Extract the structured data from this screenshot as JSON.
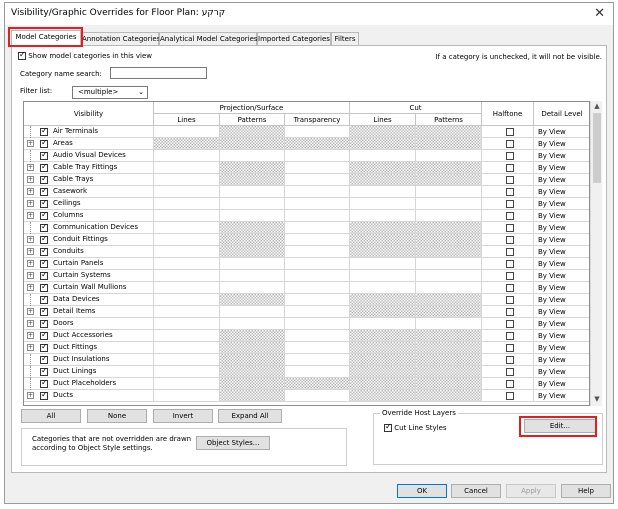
{
  "dialog": {
    "title": "Visibility/Graphic Overrides for Floor Plan: קרקע",
    "close_glyph": "✕"
  },
  "tabs": [
    {
      "label": "Model Categories",
      "active": true
    },
    {
      "label": "Annotation Categories",
      "active": false
    },
    {
      "label": "Analytical Model Categories",
      "active": false
    },
    {
      "label": "Imported Categories",
      "active": false
    },
    {
      "label": "Filters",
      "active": false
    }
  ],
  "model": {
    "show_categories_label": "Show model categories in this view",
    "show_categories_checked": true,
    "unchecked_note": "If a category is unchecked, it will not be visible.",
    "search_label": "Category name search:",
    "search_value": "",
    "filter_label": "Filter list:",
    "filter_value": "<multiple>"
  },
  "table": {
    "headers": {
      "visibility": "Visibility",
      "projection_group": "Projection/Surface",
      "lines": "Lines",
      "patterns": "Patterns",
      "transparency": "Transparency",
      "cut_group": "Cut",
      "cut_lines": "Lines",
      "cut_patterns": "Patterns",
      "halftone": "Halftone",
      "detail_level": "Detail Level"
    },
    "rows": [
      {
        "name": "Air Terminals",
        "expandable": false,
        "checked": true,
        "hatch": [
          false,
          true,
          false,
          true,
          true
        ],
        "detail": "By View"
      },
      {
        "name": "Areas",
        "expandable": true,
        "checked": true,
        "hatch": [
          true,
          true,
          true,
          true,
          true
        ],
        "detail": "By View"
      },
      {
        "name": "Audio Visual Devices",
        "expandable": false,
        "checked": true,
        "hatch": [
          false,
          false,
          false,
          false,
          false
        ],
        "detail": "By View"
      },
      {
        "name": "Cable Tray Fittings",
        "expandable": true,
        "checked": true,
        "hatch": [
          false,
          true,
          false,
          true,
          true
        ],
        "detail": "By View"
      },
      {
        "name": "Cable Trays",
        "expandable": true,
        "checked": true,
        "hatch": [
          false,
          true,
          false,
          true,
          true
        ],
        "detail": "By View"
      },
      {
        "name": "Casework",
        "expandable": true,
        "checked": true,
        "hatch": [
          false,
          false,
          false,
          false,
          false
        ],
        "detail": "By View"
      },
      {
        "name": "Ceilings",
        "expandable": true,
        "checked": true,
        "hatch": [
          false,
          false,
          false,
          false,
          false
        ],
        "detail": "By View"
      },
      {
        "name": "Columns",
        "expandable": true,
        "checked": true,
        "hatch": [
          false,
          false,
          false,
          false,
          false
        ],
        "detail": "By View"
      },
      {
        "name": "Communication Devices",
        "expandable": false,
        "checked": true,
        "hatch": [
          false,
          true,
          false,
          true,
          true
        ],
        "detail": "By View"
      },
      {
        "name": "Conduit Fittings",
        "expandable": true,
        "checked": true,
        "hatch": [
          false,
          true,
          false,
          true,
          true
        ],
        "detail": "By View"
      },
      {
        "name": "Conduits",
        "expandable": true,
        "checked": true,
        "hatch": [
          false,
          true,
          false,
          true,
          true
        ],
        "detail": "By View"
      },
      {
        "name": "Curtain Panels",
        "expandable": true,
        "checked": true,
        "hatch": [
          false,
          false,
          false,
          false,
          false
        ],
        "detail": "By View"
      },
      {
        "name": "Curtain Systems",
        "expandable": true,
        "checked": true,
        "hatch": [
          false,
          false,
          false,
          false,
          false
        ],
        "detail": "By View"
      },
      {
        "name": "Curtain Wall Mullions",
        "expandable": true,
        "checked": true,
        "hatch": [
          false,
          false,
          false,
          false,
          false
        ],
        "detail": "By View"
      },
      {
        "name": "Data Devices",
        "expandable": false,
        "checked": true,
        "hatch": [
          false,
          true,
          false,
          true,
          true
        ],
        "detail": "By View"
      },
      {
        "name": "Detail Items",
        "expandable": true,
        "checked": true,
        "hatch": [
          false,
          false,
          false,
          true,
          true
        ],
        "detail": "By View"
      },
      {
        "name": "Doors",
        "expandable": true,
        "checked": true,
        "hatch": [
          false,
          false,
          false,
          false,
          false
        ],
        "detail": "By View"
      },
      {
        "name": "Duct Accessories",
        "expandable": true,
        "checked": true,
        "hatch": [
          false,
          true,
          false,
          true,
          true
        ],
        "detail": "By View"
      },
      {
        "name": "Duct Fittings",
        "expandable": true,
        "checked": true,
        "hatch": [
          false,
          true,
          false,
          true,
          true
        ],
        "detail": "By View"
      },
      {
        "name": "Duct Insulations",
        "expandable": false,
        "checked": true,
        "hatch": [
          false,
          true,
          false,
          true,
          true
        ],
        "detail": "By View"
      },
      {
        "name": "Duct Linings",
        "expandable": false,
        "checked": true,
        "hatch": [
          false,
          true,
          false,
          true,
          true
        ],
        "detail": "By View"
      },
      {
        "name": "Duct Placeholders",
        "expandable": false,
        "checked": true,
        "hatch": [
          false,
          true,
          true,
          true,
          true
        ],
        "detail": "By View"
      },
      {
        "name": "Ducts",
        "expandable": true,
        "checked": true,
        "hatch": [
          false,
          true,
          false,
          true,
          true
        ],
        "detail": "By View"
      }
    ]
  },
  "buttons": {
    "all": "All",
    "none": "None",
    "invert": "Invert",
    "expand_all": "Expand All",
    "object_styles": "Object Styles...",
    "edit": "Edit...",
    "ok": "OK",
    "cancel": "Cancel",
    "apply": "Apply",
    "help": "Help"
  },
  "info_note": "Categories that are not overridden are drawn according to Object Style settings.",
  "override_host": {
    "legend": "Override Host Layers",
    "cut_line_styles_label": "Cut Line Styles",
    "cut_line_styles_checked": true
  },
  "scroll": {
    "up": "▲",
    "down": "▼"
  },
  "icons": {
    "expand": "+"
  }
}
